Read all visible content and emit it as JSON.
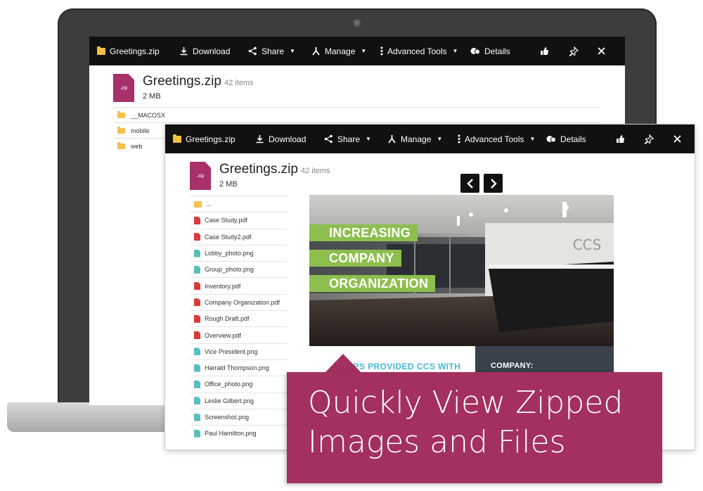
{
  "toolbar": {
    "filename": "Greetings.zip",
    "download": "Download",
    "share": "Share",
    "manage": "Manage",
    "advanced_tools": "Advanced Tools",
    "details": "Details"
  },
  "archive": {
    "title": "Greetings.zip",
    "items": "42 items",
    "size": "2 MB",
    "icon_label": ".zip"
  },
  "back_window": {
    "folders": [
      "__MACOSX",
      "mobile",
      "web"
    ]
  },
  "front_window": {
    "files": [
      {
        "name": "...",
        "type": "up"
      },
      {
        "name": "Case Study.pdf",
        "type": "pdf"
      },
      {
        "name": "Case Study2.pdf",
        "type": "pdf"
      },
      {
        "name": "Lobby_photo.png",
        "type": "png"
      },
      {
        "name": "Group_photo.png",
        "type": "png"
      },
      {
        "name": "Inventory.pdf",
        "type": "pdf"
      },
      {
        "name": "Company Organization.pdf",
        "type": "pdf"
      },
      {
        "name": "Rough Draft.pdf",
        "type": "pdf"
      },
      {
        "name": "Overview.pdf",
        "type": "pdf"
      },
      {
        "name": "Vice President.png",
        "type": "png"
      },
      {
        "name": "Harrald Thompson.png",
        "type": "png"
      },
      {
        "name": "Office_photo.png",
        "type": "png"
      },
      {
        "name": "Leslie Gilbert.png",
        "type": "png"
      },
      {
        "name": "Screenshot.png",
        "type": "png"
      },
      {
        "name": "Paul Hamilton.png",
        "type": "png"
      }
    ]
  },
  "preview": {
    "tag_lines": [
      "INCREASING",
      "COMPANY",
      "ORGANIZATION"
    ],
    "wall_logo": "CCS",
    "apps_text": "DAPPS PROVIDED CCS WITH",
    "company_label": "COMPANY:"
  },
  "callout": {
    "line1": "Quickly View Zipped",
    "line2": "Images and Files"
  },
  "colors": {
    "toolbar": "#111111",
    "zip_icon": "#a8306b",
    "callout": "#a3305f",
    "tag_green": "#8dbf4e",
    "pdf": "#d93a3a",
    "png": "#5bbdbd"
  }
}
